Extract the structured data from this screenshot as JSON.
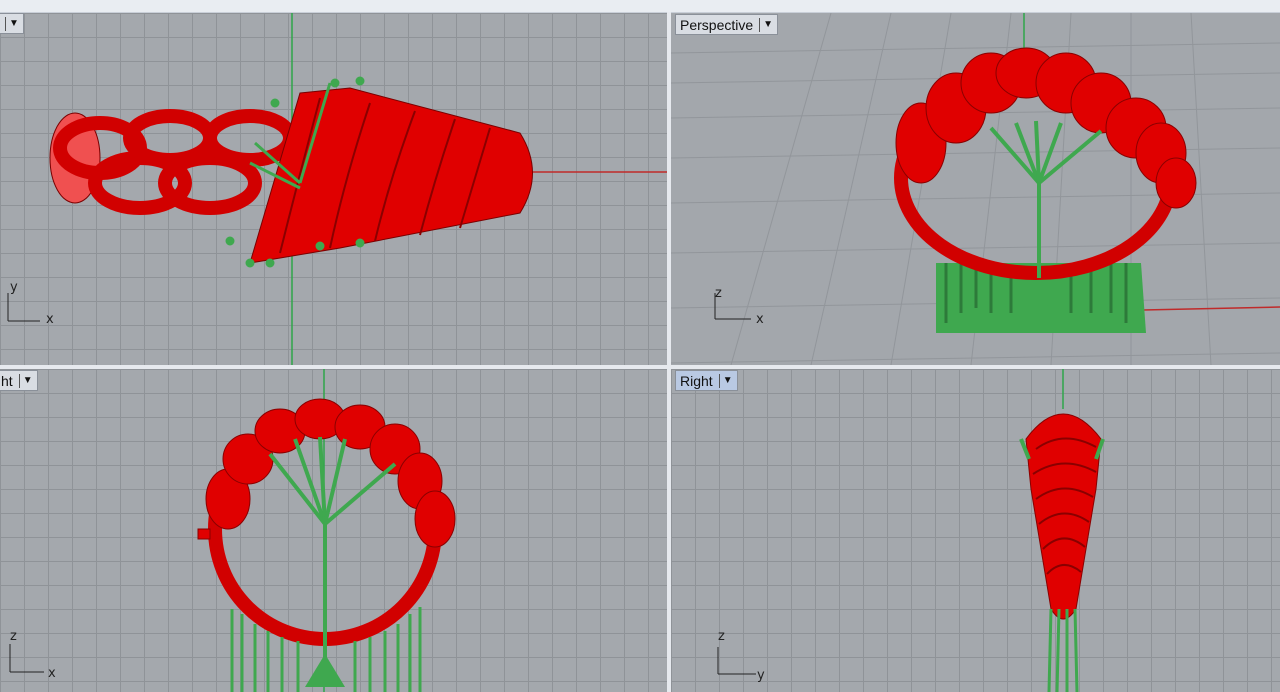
{
  "viewports": {
    "top": {
      "label": "",
      "axis_h": "x",
      "axis_v": "y"
    },
    "perspective": {
      "label": "Perspective",
      "axis_h": "x",
      "axis_v": "z"
    },
    "front": {
      "label": "ht",
      "axis_h": "x",
      "axis_v": "z"
    },
    "right": {
      "label": "Right",
      "axis_h": "y",
      "axis_v": "z"
    }
  },
  "colors": {
    "model": "#e00000",
    "support": "#3fa84f",
    "grid_bg": "#a4a8ad",
    "x_axis": "#c02a2a",
    "y_axis": "#2fa64a"
  },
  "icons": {
    "dropdown": "dropdown-arrow-icon"
  }
}
